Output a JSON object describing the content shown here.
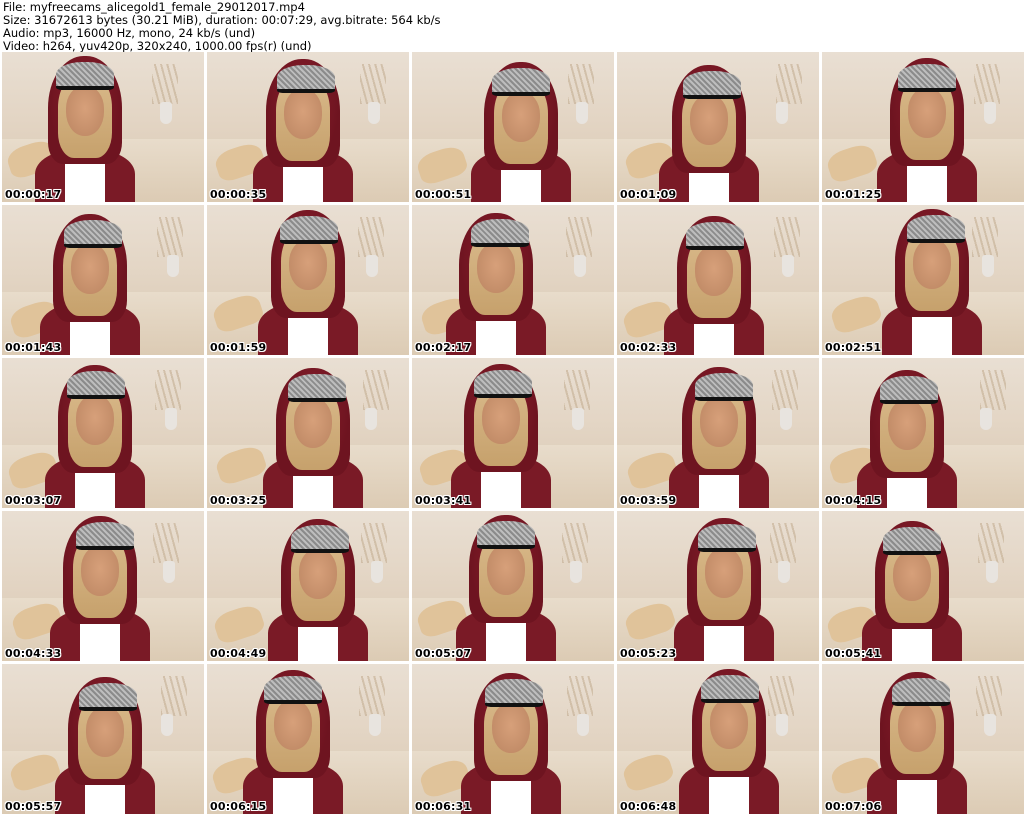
{
  "header": {
    "file": "File: myfreecams_alicegold1_female_29012017.mp4",
    "size": "Size: 31672613 bytes (30.21 MiB), duration: 00:07:29, avg.bitrate: 564 kb/s",
    "audio": "Audio: mp3, 16000 Hz, mono, 24 kb/s (und)",
    "video": "Video: h264, yuv420p, 320x240, 1000.00 fps(r) (und)"
  },
  "thumbnails": [
    {
      "timestamp": "00:00:17"
    },
    {
      "timestamp": "00:00:35"
    },
    {
      "timestamp": "00:00:51"
    },
    {
      "timestamp": "00:01:09"
    },
    {
      "timestamp": "00:01:25"
    },
    {
      "timestamp": "00:01:43"
    },
    {
      "timestamp": "00:01:59"
    },
    {
      "timestamp": "00:02:17"
    },
    {
      "timestamp": "00:02:33"
    },
    {
      "timestamp": "00:02:51"
    },
    {
      "timestamp": "00:03:07"
    },
    {
      "timestamp": "00:03:25"
    },
    {
      "timestamp": "00:03:41"
    },
    {
      "timestamp": "00:03:59"
    },
    {
      "timestamp": "00:04:15"
    },
    {
      "timestamp": "00:04:33"
    },
    {
      "timestamp": "00:04:49"
    },
    {
      "timestamp": "00:05:07"
    },
    {
      "timestamp": "00:05:23"
    },
    {
      "timestamp": "00:05:41"
    },
    {
      "timestamp": "00:05:57"
    },
    {
      "timestamp": "00:06:15"
    },
    {
      "timestamp": "00:06:31"
    },
    {
      "timestamp": "00:06:48"
    },
    {
      "timestamp": "00:07:06"
    }
  ]
}
